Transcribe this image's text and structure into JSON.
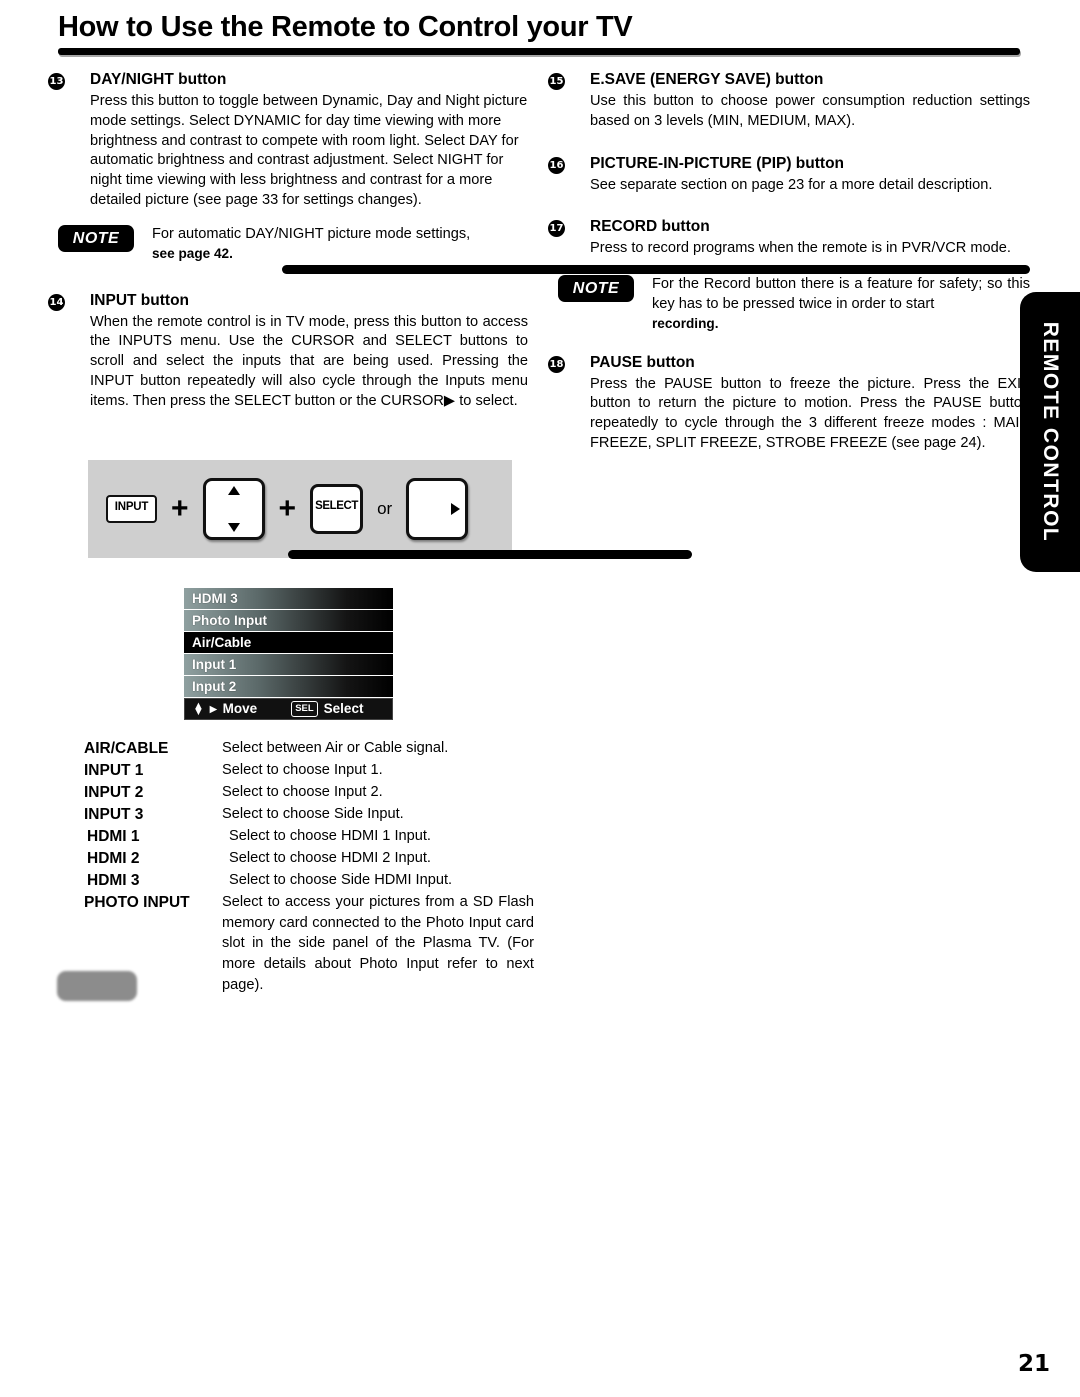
{
  "page": {
    "title": "How to Use the Remote to Control your TV",
    "number": "21",
    "side_tab": "REMOTE CONTROL"
  },
  "left_column": {
    "day_night": {
      "marker": "13",
      "heading": "DAY/NIGHT button",
      "body": "Press this button to toggle between Dynamic, Day and Night picture mode settings. Select DYNAMIC for day time viewing with more brightness and contrast to compete with room light. Select DAY for automatic brightness and contrast adjustment. Select NIGHT for night time viewing with less brightness and contrast for a more detailed picture (see page 33 for settings changes)."
    },
    "note_daynight": {
      "badge": "NOTE",
      "text": "For automatic DAY/NIGHT picture mode settings,",
      "tail": "see page 42."
    },
    "input": {
      "marker": "14",
      "heading": "INPUT button",
      "body": "When the remote control is in TV mode, press this button to access the INPUTS menu. Use the CURSOR and SELECT buttons to scroll and select the inputs that are being used. Pressing the INPUT button repeatedly will also cycle through the Inputs menu items. Then press the SELECT button  or the CURSOR",
      "body_tail": "to select."
    }
  },
  "diagram": {
    "input_key": "INPUT",
    "plus_1": "+",
    "plus_2": "+",
    "select_key": "SELECT",
    "or_label": "or"
  },
  "osd_menu": {
    "items": [
      {
        "label": "HDMI 3",
        "selected": false
      },
      {
        "label": "Photo Input",
        "selected": false
      },
      {
        "label": "Air/Cable",
        "selected": true
      },
      {
        "label": "Input 1",
        "selected": false
      },
      {
        "label": "Input 2",
        "selected": false
      }
    ],
    "footer": {
      "move_label": "Move",
      "sel_key": "SEL",
      "select_label": "Select"
    }
  },
  "input_table": {
    "rows": [
      {
        "term": "AIR/CABLE",
        "desc": "Select between Air or Cable signal."
      },
      {
        "term": "INPUT 1",
        "desc": "Select to choose Input 1."
      },
      {
        "term": "INPUT 2",
        "desc": "Select to choose Input 2."
      },
      {
        "term": "INPUT 3",
        "desc": "Select to choose Side Input."
      },
      {
        "term": "HDMI 1",
        "desc": "Select to choose HDMI 1 Input."
      },
      {
        "term": "HDMI 2",
        "desc": "Select to choose HDMI 2 Input."
      },
      {
        "term": "HDMI 3",
        "desc": "Select to choose Side HDMI Input."
      },
      {
        "term": "PHOTO INPUT",
        "desc": "Select to access your pictures from a SD Flash memory card connected to the Photo Input card slot in the side panel of the Plasma TV. (For more details about Photo Input refer to next page)."
      }
    ]
  },
  "right_column": {
    "esave": {
      "marker": "15",
      "heading": "E.SAVE (ENERGY SAVE) button",
      "body": "Use this button to choose power consumption reduction settings based on 3 levels (MIN, MEDIUM, MAX)."
    },
    "pip": {
      "marker": "16",
      "heading": "PICTURE-IN-PICTURE (PIP) button",
      "body": "See separate section on page 23 for a more detail description."
    },
    "record": {
      "marker": "17",
      "heading": "RECORD button",
      "body": "Press to record programs when the remote is in PVR/VCR mode."
    },
    "note_record": {
      "badge": "NOTE",
      "text": "For the Record button there is a feature for safety; so this key has to be pressed twice in order to start",
      "tail": "recording."
    },
    "pause": {
      "marker": "18",
      "heading": "PAUSE button",
      "body": "Press the PAUSE button to freeze the picture. Press the EXIT button to return the picture to motion. Press the PAUSE button repeatedly to cycle through the 3 different freeze modes : MAIN FREEZE, SPLIT FREEZE, STROBE FREEZE (see page 24)."
    }
  }
}
